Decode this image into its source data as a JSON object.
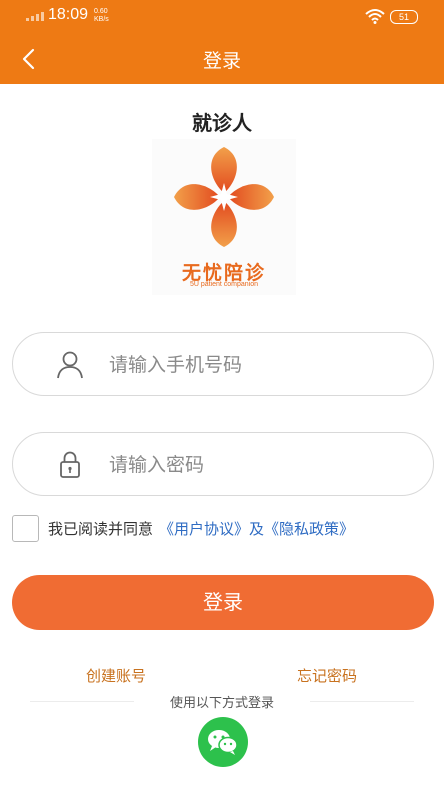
{
  "status_bar": {
    "time": "18:09",
    "net_speed_value": "0.60",
    "net_speed_unit": "KB/s",
    "battery": "51"
  },
  "nav": {
    "title": "登录"
  },
  "page": {
    "title": "就诊人"
  },
  "logo": {
    "name": "无忧陪诊",
    "tagline": "5U patient companion"
  },
  "form": {
    "phone_placeholder": "请输入手机号码",
    "password_placeholder": "请输入密码",
    "agree_text": "我已阅读并同意",
    "user_agreement": "《用户协议》",
    "and_text": "及",
    "privacy_policy": "《隐私政策》",
    "login_label": "登录"
  },
  "links": {
    "create_account": "创建账号",
    "forgot_password": "忘记密码"
  },
  "other_login": {
    "label": "使用以下方式登录"
  },
  "colors": {
    "primary": "#ee7a14",
    "button": "#f06c33",
    "link_blue": "#2f6cc3",
    "link_orange": "#c8721f",
    "wechat": "#2dc14c"
  }
}
